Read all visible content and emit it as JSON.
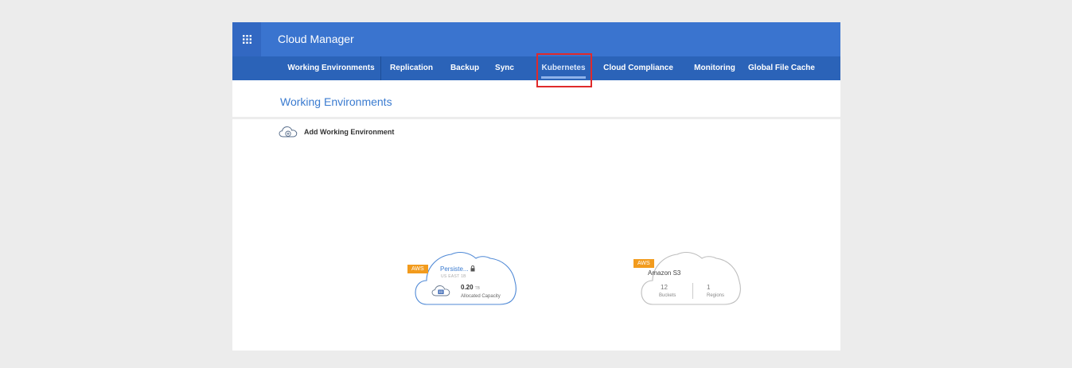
{
  "header": {
    "app_title": "Cloud Manager"
  },
  "nav": {
    "tabs": [
      {
        "label": "Working Environments"
      },
      {
        "label": "Replication"
      },
      {
        "label": "Backup"
      },
      {
        "label": "Sync"
      },
      {
        "label": "Kubernetes"
      },
      {
        "label": "Cloud Compliance"
      },
      {
        "label": "Monitoring"
      },
      {
        "label": "Global File Cache"
      }
    ],
    "active_tab": "Kubernetes"
  },
  "main": {
    "section_title": "Working Environments",
    "add_button_label": "Add Working Environment",
    "environments": [
      {
        "provider": "AWS",
        "name": "Persiste...",
        "region": "US EAST 1B",
        "locked": true,
        "capacity_value": "0.20",
        "capacity_unit": "TB",
        "capacity_label": "Allocated Capacity"
      },
      {
        "provider": "AWS",
        "name": "Amazon S3",
        "buckets_value": "12",
        "buckets_label": "Buckets",
        "regions_value": "1",
        "regions_label": "Regions"
      }
    ]
  },
  "colors": {
    "header_bg": "#3a74cf",
    "nav_bg": "#2b63b8",
    "accent_text": "#3a7bd0",
    "aws_badge": "#f29b1d",
    "highlight_border": "#e02a2a"
  },
  "icons": {
    "app_grid": "grid-icon",
    "add_environment": "cloud-add-icon",
    "lock": "lock-icon",
    "storage": "storage-icon"
  }
}
